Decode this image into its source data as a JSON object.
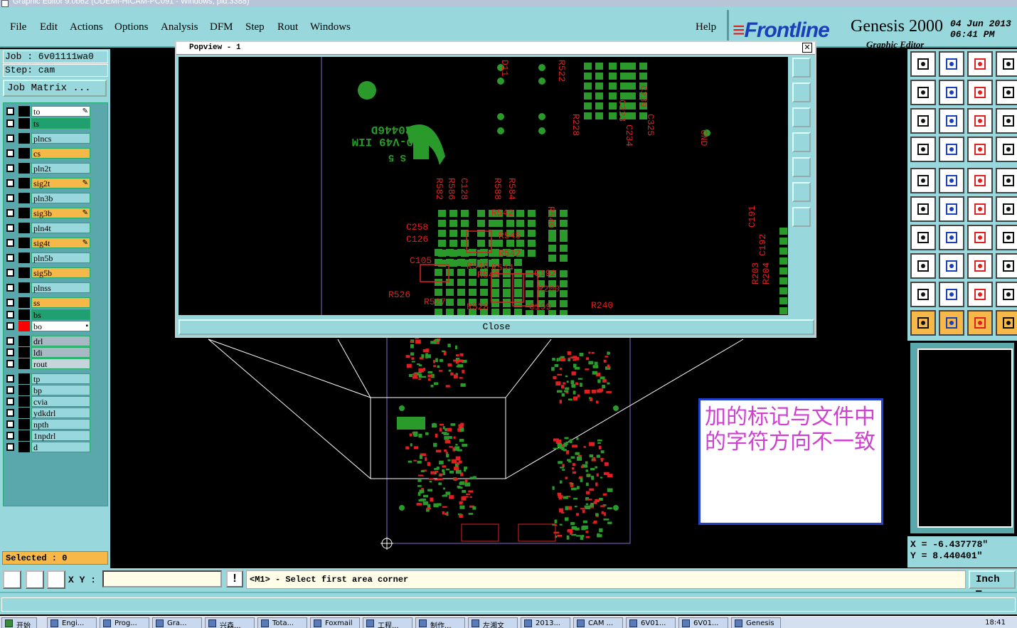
{
  "window": {
    "title": "Graphic Editor 9.0b62 (ODEMI-HICAM-PC091 - Windows, pid:3388)"
  },
  "menubar": {
    "items": [
      "File",
      "Edit",
      "Actions",
      "Options",
      "Analysis",
      "DFM",
      "Step",
      "Rout",
      "Windows"
    ],
    "help": "Help"
  },
  "brand": {
    "logo": "Frontline",
    "product": "Genesis 2000",
    "subtitle": "Graphic Editor",
    "date_line1": "04 Jun 2013",
    "date_line2": "06:41 PM"
  },
  "job": {
    "job_label": "Job : 6v01111wa0",
    "step_label": "Step: cam",
    "matrix_button": "Job Matrix ..."
  },
  "layers": [
    {
      "name": "to",
      "bg": "#ffffff",
      "chip": "#000000",
      "mark": "pen"
    },
    {
      "name": "ts",
      "bg": "#20a070",
      "chip": "#000000",
      "mark": ""
    },
    {
      "name": "plncs",
      "bg": "#98d8dc",
      "chip": "#000000",
      "mark": ""
    },
    {
      "name": "cs",
      "bg": "#f7b84a",
      "chip": "#000000",
      "mark": ""
    },
    {
      "name": "pln2t",
      "bg": "#98d8dc",
      "chip": "#000000",
      "mark": ""
    },
    {
      "name": "sig2t",
      "bg": "#f7b84a",
      "chip": "#000000",
      "mark": "pen"
    },
    {
      "name": "pln3b",
      "bg": "#98d8dc",
      "chip": "#000000",
      "mark": ""
    },
    {
      "name": "sig3b",
      "bg": "#f7b84a",
      "chip": "#000000",
      "mark": "pen"
    },
    {
      "name": "pln4t",
      "bg": "#98d8dc",
      "chip": "#000000",
      "mark": ""
    },
    {
      "name": "sig4t",
      "bg": "#f7b84a",
      "chip": "#000000",
      "mark": "pen"
    },
    {
      "name": "pln5b",
      "bg": "#98d8dc",
      "chip": "#000000",
      "mark": ""
    },
    {
      "name": "sig5b",
      "bg": "#f7b84a",
      "chip": "#000000",
      "mark": ""
    },
    {
      "name": "plnss",
      "bg": "#98d8dc",
      "chip": "#000000",
      "mark": ""
    },
    {
      "name": "ss",
      "bg": "#f7b84a",
      "chip": "#000000",
      "mark": ""
    },
    {
      "name": "bs",
      "bg": "#20a070",
      "chip": "#000000",
      "mark": ""
    },
    {
      "name": "bo",
      "bg": "#ffffff",
      "chip": "#ff0000",
      "mark": "box"
    },
    {
      "name": "drl",
      "bg": "#a8b8c4",
      "chip": "#000000",
      "mark": ""
    },
    {
      "name": "ldi",
      "bg": "#a8b8c4",
      "chip": "#000000",
      "mark": ""
    },
    {
      "name": "rout",
      "bg": "#c8d4dc",
      "chip": "#000000",
      "mark": ""
    },
    {
      "name": "tp",
      "bg": "#98d8dc",
      "chip": "#000000",
      "mark": ""
    },
    {
      "name": "bp",
      "bg": "#98d8dc",
      "chip": "#000000",
      "mark": ""
    },
    {
      "name": "cvia",
      "bg": "#98d8dc",
      "chip": "#000000",
      "mark": ""
    },
    {
      "name": "ydkdrl",
      "bg": "#98d8dc",
      "chip": "#000000",
      "mark": ""
    },
    {
      "name": "npth",
      "bg": "#98d8dc",
      "chip": "#000000",
      "mark": ""
    },
    {
      "name": "1npdrl",
      "bg": "#98d8dc",
      "chip": "#000000",
      "mark": ""
    },
    {
      "name": "d",
      "bg": "#98d8dc",
      "chip": "#000000",
      "mark": ""
    }
  ],
  "selected": "Selected : 0",
  "popview": {
    "title": "Popview - 1",
    "close_label": "Close",
    "board_text": {
      "marking_code": "E20446D",
      "marking_code2": "0-V49 IIM",
      "marking_code3": "S 5",
      "labels_top": [
        "D11",
        "R522",
        "R228",
        "C223",
        "C239",
        "C325",
        "C234"
      ],
      "labels_mid": [
        "R582",
        "R586",
        "C128",
        "R588",
        "R584",
        "R540",
        "R542",
        "C258",
        "C126",
        "R545",
        "R542",
        "R544",
        "R543",
        "C192",
        "R548",
        "C105",
        "R526",
        "R527",
        "R528",
        "C199",
        "R200",
        "R240",
        "CND"
      ],
      "labels_right": [
        "C191",
        "C192",
        "R203",
        "R204"
      ]
    }
  },
  "annotation": {
    "text": "加的标记与文件中的字符方向不一致"
  },
  "coords": {
    "x": "X = -6.437778\"",
    "y": "Y = 8.440401\""
  },
  "bottombar": {
    "xy_label": "X Y :",
    "xy_value": "",
    "warn": "!",
    "prompt": "<M1> - Select first area corner",
    "units": "Inch"
  },
  "taskbar": {
    "start": "开始",
    "tasks": [
      "Engi...",
      "Prog...",
      "Gra...",
      "兴森...",
      "Tota...",
      "Foxmail",
      "工程...",
      "制作...",
      "左湘文",
      "2013...",
      "CAM ...",
      "6V01...",
      "6V01...",
      "Genesis"
    ],
    "clock": "18:41"
  },
  "colors": {
    "accent_cyan": "#98d8dc",
    "orange": "#f7b84a",
    "pcb_green": "#2a9a2a",
    "pcb_red": "#e02020",
    "annot_text": "#d040d0",
    "annot_border": "#2040d0"
  }
}
